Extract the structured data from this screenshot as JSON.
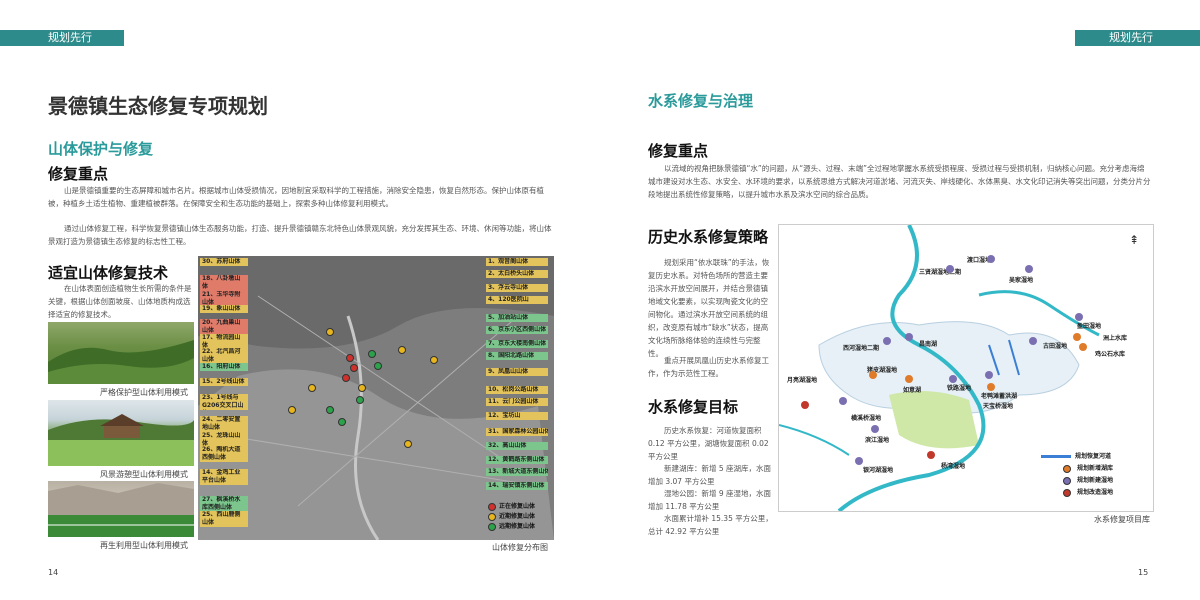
{
  "left": {
    "tag": "规划先行",
    "title": "景德镇生态修复专项规划",
    "section": "山体保护与修复",
    "focus_heading": "修复重点",
    "para1": "山是景德镇重要的生态屏障和城市名片。根据城市山体受损情况，因地制宜采取科学的工程措施，消除安全隐患，恢复自然形态。保护山体原有植被，种植乡土适生植物、重建植被群落。在保障安全和生态功能的基础上，探索多种山体修复利用模式。",
    "para2": "通过山体修复工程，科学恢复景德镇山体生态服务功能，打造、提升景德镇赣东北特色山体景观风貌，充分发挥其生态、环境、休闲等功能，将山体景观打造为景德镇生态修复的标志性工程。",
    "tech_heading": "适宜山体修复技术",
    "tech_para": "在山体表面创造植物生长所需的条件是关键，根据山体创面坡度、山体地质构成选择适宜的修复技术。",
    "caption1": "严格保护型山体利用模式",
    "caption2": "风景游憩型山体利用模式",
    "caption3": "再生利用型山体利用模式",
    "map_caption": "山体修复分布图",
    "page_num": "14",
    "map_labels_left": [
      {
        "text": "30、苏府山体",
        "c": "y"
      },
      {
        "text": "18、八卦墩山体",
        "c": "r"
      },
      {
        "text": "21、玉华寺附山体",
        "c": "r"
      },
      {
        "text": "19、象山山体",
        "c": "y"
      },
      {
        "text": "20、九曲巢山山体",
        "c": "r"
      },
      {
        "text": "17、物流园山体",
        "c": "y"
      },
      {
        "text": "22、北汽昌河山体",
        "c": "y"
      },
      {
        "text": "16、阳府山体",
        "c": "g"
      },
      {
        "text": "15、2号线山体",
        "c": "y"
      },
      {
        "text": "23、1号线与G206交叉口山体",
        "c": "y"
      },
      {
        "text": "24、二零安置地山体",
        "c": "y"
      },
      {
        "text": "25、龙珠山山体",
        "c": "y"
      },
      {
        "text": "26、陶机大道西侧山体",
        "c": "y"
      },
      {
        "text": "14、金鸡工业平台山体",
        "c": "y"
      },
      {
        "text": "27、枫溪桥水库西侧山体",
        "c": "g"
      },
      {
        "text": "25、西山鹿侧山体",
        "c": "y"
      }
    ],
    "map_labels_right": [
      {
        "text": "1、观音阁山体",
        "c": "y"
      },
      {
        "text": "2、太白桥头山体",
        "c": "y"
      },
      {
        "text": "3、浮云寺山体",
        "c": "y"
      },
      {
        "text": "4、120医院山",
        "c": "y"
      },
      {
        "text": "5、加油站山体",
        "c": "g"
      },
      {
        "text": "6、京东小区西侧山体",
        "c": "g"
      },
      {
        "text": "7、京东大楼南侧山体",
        "c": "g"
      },
      {
        "text": "8、国阳北路山体",
        "c": "g"
      },
      {
        "text": "9、凤凰山山体",
        "c": "y"
      },
      {
        "text": "10、松岗公路山体",
        "c": "y"
      },
      {
        "text": "11、云门公园山体",
        "c": "y"
      },
      {
        "text": "12、宝坊山",
        "c": "y"
      },
      {
        "text": "31、国家森林公园山体",
        "c": "y"
      },
      {
        "text": "32、高山山体",
        "c": "g"
      },
      {
        "text": "12、黄鹤路东侧山体",
        "c": "g"
      },
      {
        "text": "13、新城大道东侧山体",
        "c": "g"
      },
      {
        "text": "14、瑞安镇东侧山体",
        "c": "g"
      }
    ],
    "legend": [
      {
        "text": "正在修复山体",
        "color": "#d0312d"
      },
      {
        "text": "近期修复山体",
        "color": "#e7b61c"
      },
      {
        "text": "远期修复山体",
        "color": "#2ca24a"
      }
    ]
  },
  "right": {
    "tag": "规划先行",
    "section": "水系修复与治理",
    "focus_heading": "修复重点",
    "focus_para": "以流域的视角把脉景德镇“水”的问题，从“源头、过程、末端”全过程地掌握水系统受损程度、受损过程与受损机制，归纳核心问题。充分考虑海绵城市建设对水生态、水安全、水环境的要求，以系统思维方式解决河道淤堵、河流灭失、岸线硬化、水体黑臭、水文化印记消失等突出问题，分类分片分段地提出系统性修复策略，以提升城市水系及滨水空间的综合品质。",
    "hist_heading": "历史水系修复策略",
    "hist_para1": "规划采用“依水联珠”的手法，恢复历史水系。对特色场所的营造主要沿滨水开放空间展开，并结合景德镇地域文化要素，以实现陶瓷文化的空间物化。通过滨水开放空间系统的组织，改变原有城市“缺水”状态，提高文化场所脉络体验的连续性与完整性。",
    "hist_para2": "重点开展凤凰山历史水系修复工作，作为示范性工程。",
    "goal_heading": "水系修复目标",
    "goal_1": "历史水系恢复：河道恢复面积0.12 平方公里，湖塘恢复面积 0.02平方公里",
    "goal_2": "新建湖库：新增 5 座湖库，水面增加 3.07 平方公里",
    "goal_3": "湿地公园：新增 9 座湿地，水面增加 11.78 平方公里",
    "goal_4": "水面累计增补 15.35 平方公里，总计 42.92 平方公里",
    "map_caption": "水系修复项目库",
    "page_num": "15",
    "map_labels": [
      {
        "text": "渡口湿地"
      },
      {
        "text": "三贤湖湿地二期"
      },
      {
        "text": "吴家湿地"
      },
      {
        "text": "盈田湿地"
      },
      {
        "text": "洲上水库"
      },
      {
        "text": "鸡公石水库"
      },
      {
        "text": "西河湿地二期"
      },
      {
        "text": "昌南湖"
      },
      {
        "text": "古田湿地"
      },
      {
        "text": "猪皮湖湿地"
      },
      {
        "text": "如意湖"
      },
      {
        "text": "铁路湿地"
      },
      {
        "text": "老鸭滩蓄洪湖"
      },
      {
        "text": "天宝桥湿地"
      },
      {
        "text": "月亮湖湿地"
      },
      {
        "text": "横溪桥湿地"
      },
      {
        "text": "滨江湿地"
      },
      {
        "text": "银河湖湿地"
      },
      {
        "text": "杨湾湿地"
      }
    ],
    "legend": [
      {
        "text": "规划恢复河道",
        "color": "#3a7fd5"
      },
      {
        "text": "规划新增湖库",
        "color": "#e07b2a"
      },
      {
        "text": "规划新建湿地",
        "color": "#7a6fb0"
      },
      {
        "text": "规划改造湿地",
        "color": "#c0392b"
      }
    ]
  }
}
